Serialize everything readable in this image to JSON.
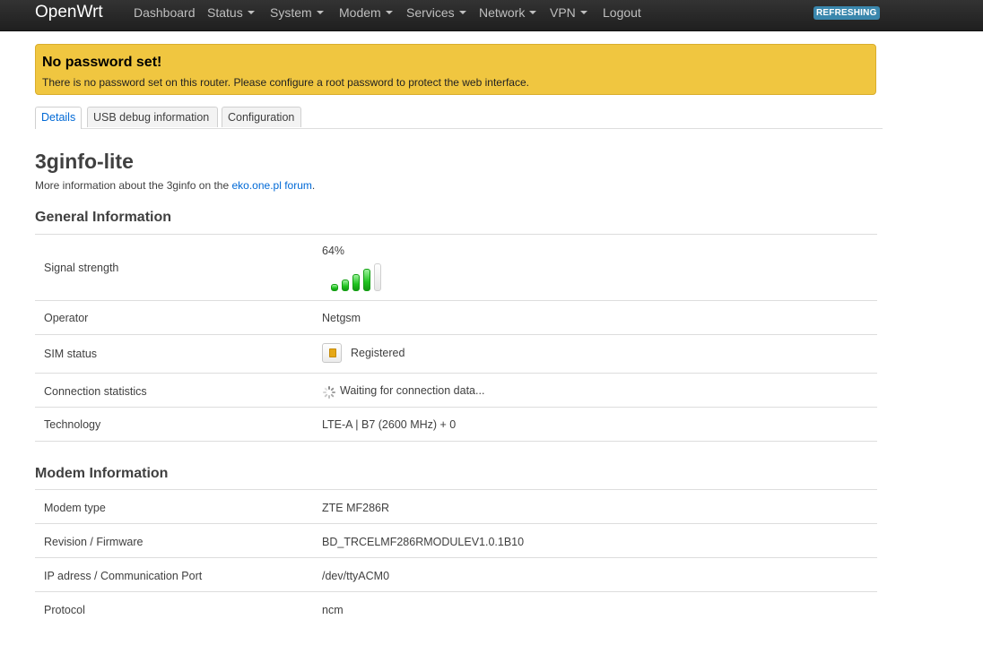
{
  "brand": "OpenWrt",
  "nav": {
    "dashboard": "Dashboard",
    "status": "Status",
    "system": "System",
    "modem": "Modem",
    "services": "Services",
    "network": "Network",
    "vpn": "VPN",
    "logout": "Logout",
    "indicator": "REFRESHING"
  },
  "alert": {
    "title": "No password set!",
    "message": "There is no password set on this router. Please configure a root password to protect the web interface."
  },
  "tabs": [
    "Details",
    "USB debug information",
    "Configuration"
  ],
  "page": {
    "title": "3ginfo-lite",
    "desc_prefix": "More information about the 3ginfo on the ",
    "desc_link": "eko.one.pl forum",
    "desc_suffix": "."
  },
  "general": {
    "title": "General Information",
    "signal_label": "Signal strength",
    "signal_value": "64%",
    "signal_bars_filled": 4,
    "signal_bars_total": 5,
    "operator_label": "Operator",
    "operator_value": "Netgsm",
    "sim_label": "SIM status",
    "sim_value": "Registered",
    "conn_label": "Connection statistics",
    "conn_value": "Waiting for connection data...",
    "tech_label": "Technology",
    "tech_value": "LTE-A | B7 (2600 MHz) + 0"
  },
  "modem": {
    "title": "Modem Information",
    "rows": [
      {
        "label": "Modem type",
        "value": "ZTE MF286R"
      },
      {
        "label": "Revision / Firmware",
        "value": "BD_TRCELMF286RMODULEV1.0.1B10"
      },
      {
        "label": "IP adress / Communication Port",
        "value": "/dev/ttyACM0"
      },
      {
        "label": "Protocol",
        "value": "ncm"
      }
    ]
  },
  "colors": {
    "navbar": "#222222",
    "alert": "#f0c640",
    "link": "#0069d6",
    "badge": "#3a87ad",
    "signal": "#1fc31f"
  }
}
